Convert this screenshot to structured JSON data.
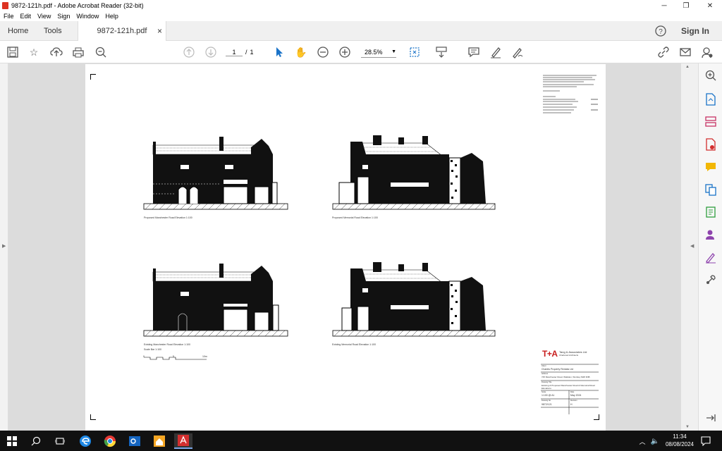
{
  "window": {
    "title": "9872-121h.pdf - Adobe Acrobat Reader (32-bit)"
  },
  "menu": [
    "File",
    "Edit",
    "View",
    "Sign",
    "Window",
    "Help"
  ],
  "tabs": {
    "home": "Home",
    "tools": "Tools",
    "doc": "9872-121h.pdf",
    "close": "×",
    "signin": "Sign In"
  },
  "toolbar": {
    "page_current": "1",
    "page_sep": "/",
    "page_total": "1",
    "zoom": "28.5%"
  },
  "drawing": {
    "cap1": "Proposed Manchester Road Elevation   1:100",
    "cap2": "Proposed Memorial Road Elevation   1:100",
    "cap3": "Existing Manchester Road Elevation   1:100",
    "cap4": "Existing Memorial Road Elevation   1:100",
    "scalebar": "Scale Bar   1:100",
    "scale_ticks": [
      "0",
      "5",
      "10m"
    ],
    "firm": "Tang & Associates Ltd",
    "firm_sub": "Chartered Architects",
    "client_label": "Client",
    "client": "Charles Property Rentals Ltd",
    "address_label": "Address",
    "address": "745 Manchester Road, Walkden, Worsley M28 3NB",
    "dwgtitle_label": "Drawing Title",
    "dwgtitle": "Existing & Proposed Manchester Road & Memorial Road Elevations",
    "scale_label": "Scale",
    "scale": "1:100 @ A1",
    "date_label": "Date",
    "date": "May 2024",
    "dwgno_label": "Drawing No.",
    "dwgno": "9872/121",
    "rev_label": "Revision",
    "rev": "H"
  },
  "taskbar": {
    "time": "11:34",
    "date": "08/08/2024"
  },
  "colors": {
    "brand_red": "#c81e1e",
    "acrobat_red": "#d32f2f"
  }
}
